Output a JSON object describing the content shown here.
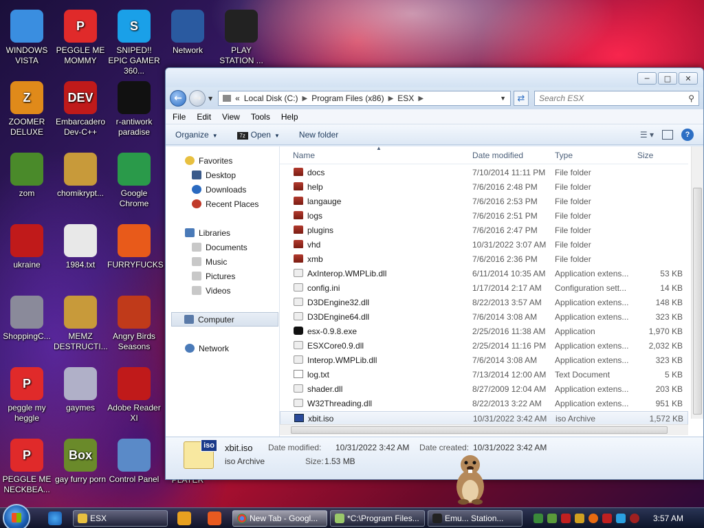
{
  "desktop": {
    "icons": [
      {
        "label": "WINDOWS VISTA",
        "color": "#3a8ee0",
        "glyph": ""
      },
      {
        "label": "PEGGLE ME MOMMY",
        "color": "#e02a2a",
        "glyph": "P"
      },
      {
        "label": "SNIPED!! EPIC GAMER 360...",
        "color": "#1aa0e8",
        "glyph": "S"
      },
      {
        "label": "Network",
        "color": "#2a5aa0",
        "glyph": ""
      },
      {
        "label": "PLAY STATION ...",
        "color": "#222222",
        "glyph": ""
      },
      {
        "label": "ZOOMER DELUXE",
        "color": "#e08a1a",
        "glyph": "Z"
      },
      {
        "label": "Embarcadero Dev-C++",
        "color": "#c01a1a",
        "glyph": "DEV"
      },
      {
        "label": "r-antiwork paradise",
        "color": "#111111",
        "glyph": ""
      },
      {
        "label": "zom",
        "color": "#4a8a2a",
        "glyph": ""
      },
      {
        "label": "chomikrypt...",
        "color": "#c89a3a",
        "glyph": ""
      },
      {
        "label": "Google Chrome",
        "color": "#2a9a4a",
        "glyph": ""
      },
      {
        "label": "ukraine",
        "color": "#c01a1a",
        "glyph": ""
      },
      {
        "label": "1984.txt",
        "color": "#e8e8e8",
        "glyph": ""
      },
      {
        "label": "FURRYFUCKS",
        "color": "#e85a1a",
        "glyph": ""
      },
      {
        "label": "ShoppingC...",
        "color": "#8a8a9a",
        "glyph": ""
      },
      {
        "label": "MEMZ DESTRUCTI...",
        "color": "#c89a3a",
        "glyph": ""
      },
      {
        "label": "Angry Birds Seasons",
        "color": "#c03a1a",
        "glyph": ""
      },
      {
        "label": "peggle my heggle",
        "color": "#e02a2a",
        "glyph": "P"
      },
      {
        "label": "gaymes",
        "color": "#b0b0c8",
        "glyph": ""
      },
      {
        "label": "Adobe Reader XI",
        "color": "#c01a1a",
        "glyph": ""
      },
      {
        "label": "PEGGLE ME NECKBEA...",
        "color": "#e02a2a",
        "glyph": "P"
      },
      {
        "label": "gay furry porn",
        "color": "#6a8a2a",
        "glyph": "Box"
      },
      {
        "label": "Control Panel",
        "color": "#5a8ac8",
        "glyph": ""
      },
      {
        "label": "PORN PLAYER",
        "color": "#333333",
        "glyph": ""
      }
    ]
  },
  "explorer": {
    "breadcrumb": [
      "«",
      "Local Disk (C:)",
      "Program Files (x86)",
      "ESX"
    ],
    "search_placeholder": "Search ESX",
    "menu": [
      "File",
      "Edit",
      "View",
      "Tools",
      "Help"
    ],
    "toolbar": {
      "organize": "Organize",
      "open": "Open",
      "new_folder": "New folder"
    },
    "nav": {
      "favorites": "Favorites",
      "desktop": "Desktop",
      "downloads": "Downloads",
      "recent": "Recent Places",
      "libraries": "Libraries",
      "documents": "Documents",
      "music": "Music",
      "pictures": "Pictures",
      "videos": "Videos",
      "computer": "Computer",
      "network": "Network"
    },
    "columns": {
      "name": "Name",
      "date": "Date modified",
      "type": "Type",
      "size": "Size"
    },
    "files": [
      {
        "name": "docs",
        "date": "7/10/2014 11:11 PM",
        "type": "File folder",
        "size": "",
        "kind": "folder"
      },
      {
        "name": "help",
        "date": "7/6/2016 2:48 PM",
        "type": "File folder",
        "size": "",
        "kind": "folder"
      },
      {
        "name": "langauge",
        "date": "7/6/2016 2:53 PM",
        "type": "File folder",
        "size": "",
        "kind": "folder"
      },
      {
        "name": "logs",
        "date": "7/6/2016 2:51 PM",
        "type": "File folder",
        "size": "",
        "kind": "folder"
      },
      {
        "name": "plugins",
        "date": "7/6/2016 2:47 PM",
        "type": "File folder",
        "size": "",
        "kind": "folder"
      },
      {
        "name": "vhd",
        "date": "10/31/2022 3:07 AM",
        "type": "File folder",
        "size": "",
        "kind": "folder"
      },
      {
        "name": "xmb",
        "date": "7/6/2016 2:36 PM",
        "type": "File folder",
        "size": "",
        "kind": "folder"
      },
      {
        "name": "AxInterop.WMPLib.dll",
        "date": "6/11/2014 10:35 AM",
        "type": "Application extens...",
        "size": "53 KB",
        "kind": "dll"
      },
      {
        "name": "config.ini",
        "date": "1/17/2014 2:17 AM",
        "type": "Configuration sett...",
        "size": "14 KB",
        "kind": "dll"
      },
      {
        "name": "D3DEngine32.dll",
        "date": "8/22/2013 3:57 AM",
        "type": "Application extens...",
        "size": "148 KB",
        "kind": "dll"
      },
      {
        "name": "D3DEngine64.dll",
        "date": "7/6/2014 3:08 AM",
        "type": "Application extens...",
        "size": "323 KB",
        "kind": "dll"
      },
      {
        "name": "esx-0.9.8.exe",
        "date": "2/25/2016 11:38 AM",
        "type": "Application",
        "size": "1,970 KB",
        "kind": "exe"
      },
      {
        "name": "ESXCore0.9.dll",
        "date": "2/25/2014 11:16 PM",
        "type": "Application extens...",
        "size": "2,032 KB",
        "kind": "dll"
      },
      {
        "name": "Interop.WMPLib.dll",
        "date": "7/6/2014 3:08 AM",
        "type": "Application extens...",
        "size": "323 KB",
        "kind": "dll"
      },
      {
        "name": "log.txt",
        "date": "7/13/2014 12:00 AM",
        "type": "Text Document",
        "size": "5 KB",
        "kind": "txt"
      },
      {
        "name": "shader.dll",
        "date": "8/27/2009 12:04 AM",
        "type": "Application extens...",
        "size": "203 KB",
        "kind": "dll"
      },
      {
        "name": "W32Threading.dll",
        "date": "8/22/2013 3:22 AM",
        "type": "Application extens...",
        "size": "951 KB",
        "kind": "dll"
      },
      {
        "name": "xbit.iso",
        "date": "10/31/2022 3:42 AM",
        "type": "iso Archive",
        "size": "1,572 KB",
        "kind": "iso",
        "selected": true
      }
    ],
    "details": {
      "name": "xbit.iso",
      "type": "iso Archive",
      "modified_label": "Date modified:",
      "modified": "10/31/2022 3:42 AM",
      "created_label": "Date created:",
      "created": "10/31/2022 3:42 AM",
      "size_label": "Size:",
      "size": "1.53 MB"
    }
  },
  "taskbar": {
    "items": [
      {
        "label": "ESX",
        "active": false
      },
      {
        "label": "New Tab - Googl...",
        "active": true
      },
      {
        "label": "*C:\\Program Files...",
        "active": false
      },
      {
        "label": "Emu... Station...",
        "active": false
      }
    ],
    "clock": "3:57 AM"
  }
}
